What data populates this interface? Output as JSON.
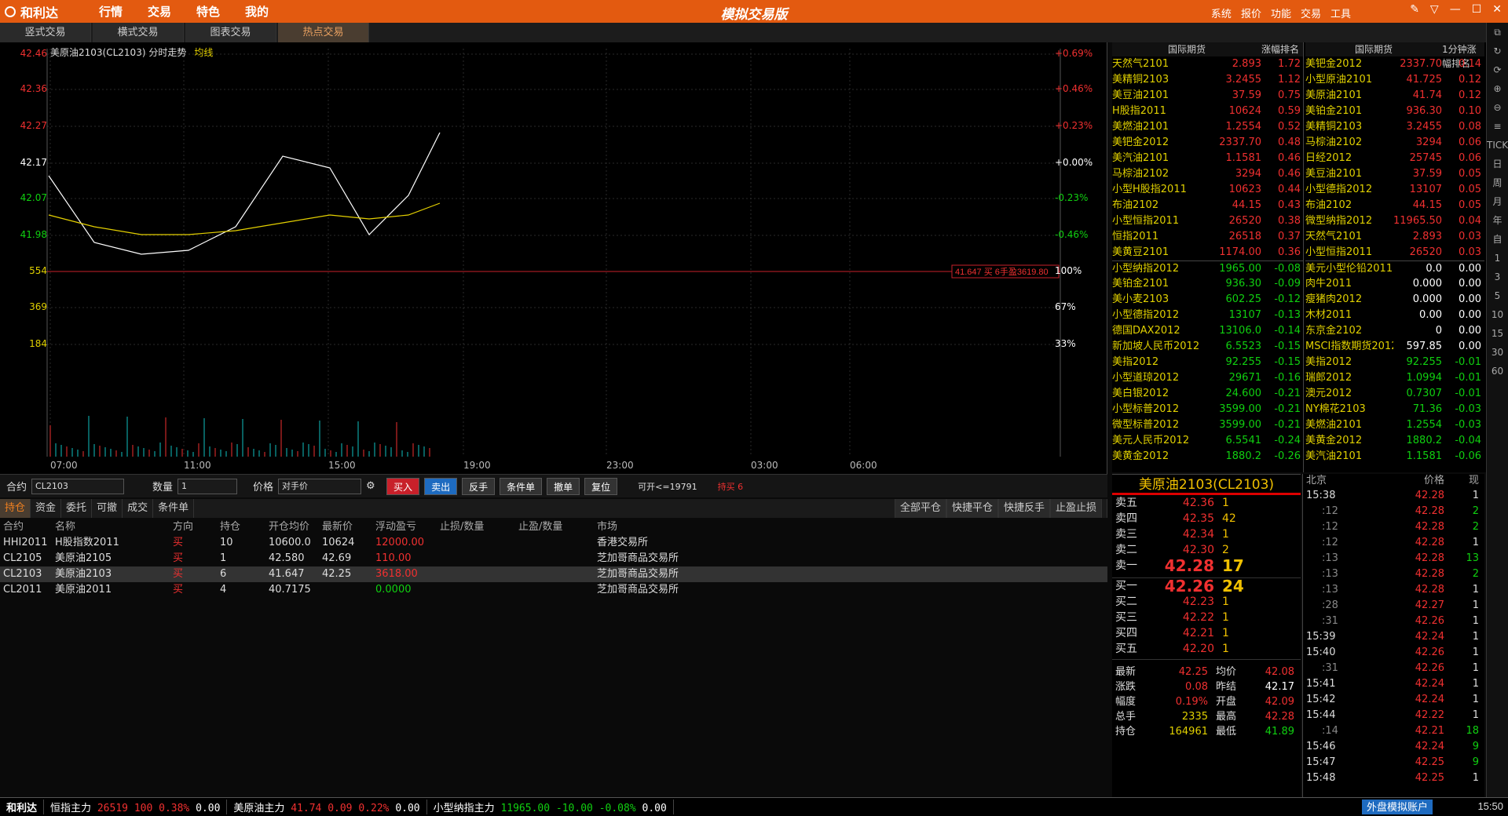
{
  "app": {
    "logo": "和利达",
    "title": "模拟交易版",
    "menu": [
      "行情",
      "交易",
      "特色",
      "我的"
    ],
    "sys": [
      "系统",
      "报价",
      "功能",
      "交易",
      "工具"
    ]
  },
  "tabs": [
    "竖式交易",
    "横式交易",
    "图表交易",
    "热点交易"
  ],
  "chart": {
    "title": "美原油2103(CL2103) 分时走势",
    "avg_label": "均线",
    "left_labels": [
      "42.46",
      "42.36",
      "42.27",
      "42.17",
      "42.07",
      "41.98",
      "554",
      "369",
      "184"
    ],
    "right_labels": [
      "+0.69%",
      "+0.46%",
      "+0.23%",
      "+0.00%",
      "-0.23%",
      "-0.46%",
      "100%",
      "67%",
      "33%"
    ],
    "time_labels": [
      "07:00",
      "11:00",
      "15:00",
      "19:00",
      "23:00",
      "03:00",
      "06:00"
    ],
    "position_tag": "41.647 买 6手盈3619.80"
  },
  "chart_data": {
    "type": "line",
    "title": "美原油2103(CL2103) 分时走势",
    "x": [
      "07:00",
      "08:00",
      "09:00",
      "10:00",
      "11:00",
      "12:00",
      "13:00",
      "14:00",
      "15:00",
      "15:30"
    ],
    "series": [
      {
        "name": "价格",
        "values": [
          42.15,
          41.98,
          41.95,
          41.96,
          42.02,
          42.2,
          42.17,
          42.0,
          42.1,
          42.26
        ]
      },
      {
        "name": "均线",
        "values": [
          42.05,
          42.02,
          42.0,
          42.0,
          42.01,
          42.03,
          42.05,
          42.04,
          42.05,
          42.08
        ]
      }
    ],
    "ylim": [
      41.98,
      42.46
    ]
  },
  "order": {
    "contract_label": "合约",
    "contract": "CL2103",
    "qty_label": "数量",
    "qty": "1",
    "price_label": "价格",
    "price": "对手价",
    "buy": "买入",
    "sell": "卖出",
    "reverse": "反手",
    "cond": "条件单",
    "cancel": "撤单",
    "reset": "复位",
    "available": "可开<=19791",
    "holding": "持买 6"
  },
  "pos_tabs": [
    "持仓",
    "资金",
    "委托",
    "可撤",
    "成交",
    "条件单"
  ],
  "pos_actions": [
    "全部平仓",
    "快捷平仓",
    "快捷反手",
    "止盈止损"
  ],
  "table": {
    "headers": [
      "合约",
      "名称",
      "方向",
      "持仓",
      "开仓均价",
      "最新价",
      "浮动盈亏",
      "止损/数量",
      "止盈/数量",
      "市场"
    ],
    "rows": [
      [
        "HHI2011",
        "H股指数2011",
        "买",
        "10",
        "10600.0",
        "10624",
        "12000.00",
        "",
        "",
        "香港交易所"
      ],
      [
        "CL2105",
        "美原油2105",
        "买",
        "1",
        "42.580",
        "42.69",
        "110.00",
        "",
        "",
        "芝加哥商品交易所"
      ],
      [
        "CL2103",
        "美原油2103",
        "买",
        "6",
        "41.647",
        "42.25",
        "3618.00",
        "",
        "",
        "芝加哥商品交易所"
      ],
      [
        "CL2011",
        "美原油2011",
        "买",
        "4",
        "40.7175",
        "",
        "0.0000",
        "",
        "",
        "芝加哥商品交易所"
      ]
    ]
  },
  "rank1": {
    "h1": "国际期货",
    "h2": "涨幅排名",
    "rows": [
      [
        "天然气2101",
        "2.893",
        "1.72"
      ],
      [
        "美精铜2103",
        "3.2455",
        "1.12"
      ],
      [
        "美豆油2101",
        "37.59",
        "0.75"
      ],
      [
        "H股指2011",
        "10624",
        "0.59"
      ],
      [
        "美燃油2101",
        "1.2554",
        "0.52"
      ],
      [
        "美钯金2012",
        "2337.70",
        "0.48"
      ],
      [
        "美汽油2101",
        "1.1581",
        "0.46"
      ],
      [
        "马棕油2102",
        "3294",
        "0.46"
      ],
      [
        "小型H股指2011",
        "10623",
        "0.44"
      ],
      [
        "布油2102",
        "44.15",
        "0.43"
      ],
      [
        "小型恒指2011",
        "26520",
        "0.38"
      ],
      [
        "恒指2011",
        "26518",
        "0.37"
      ],
      [
        "美黄豆2101",
        "1174.00",
        "0.36"
      ],
      [
        "小型纳指2012",
        "1965.00",
        "-0.08"
      ],
      [
        "美铂金2101",
        "936.30",
        "-0.09"
      ],
      [
        "美小麦2103",
        "602.25",
        "-0.12"
      ],
      [
        "小型德指2012",
        "13107",
        "-0.13"
      ],
      [
        "德国DAX2012",
        "13106.0",
        "-0.14"
      ],
      [
        "新加坡人民币2012",
        "6.5523",
        "-0.15"
      ],
      [
        "美指2012",
        "92.255",
        "-0.15"
      ],
      [
        "小型道琼2012",
        "29671",
        "-0.16"
      ],
      [
        "美白银2012",
        "24.600",
        "-0.21"
      ],
      [
        "小型标普2012",
        "3599.00",
        "-0.21"
      ],
      [
        "微型标普2012",
        "3599.00",
        "-0.21"
      ],
      [
        "美元人民币2012",
        "6.5541",
        "-0.24"
      ],
      [
        "美黄金2012",
        "1880.2",
        "-0.26"
      ]
    ]
  },
  "rank2": {
    "h1": "国际期货",
    "h2": "1分钟涨幅排名",
    "rows": [
      [
        "美钯金2012",
        "2337.70",
        "0.14"
      ],
      [
        "小型原油2101",
        "41.725",
        "0.12"
      ],
      [
        "美原油2101",
        "41.74",
        "0.12"
      ],
      [
        "美铂金2101",
        "936.30",
        "0.10"
      ],
      [
        "美精铜2103",
        "3.2455",
        "0.08"
      ],
      [
        "马棕油2102",
        "3294",
        "0.06"
      ],
      [
        "日经2012",
        "25745",
        "0.06"
      ],
      [
        "美豆油2101",
        "37.59",
        "0.05"
      ],
      [
        "小型德指2012",
        "13107",
        "0.05"
      ],
      [
        "布油2102",
        "44.15",
        "0.05"
      ],
      [
        "微型纳指2012",
        "11965.50",
        "0.04"
      ],
      [
        "天然气2101",
        "2.893",
        "0.03"
      ],
      [
        "小型恒指2011",
        "26520",
        "0.03"
      ],
      [
        "美元小型伦铅2011",
        "0.0",
        "0.00"
      ],
      [
        "肉牛2011",
        "0.000",
        "0.00"
      ],
      [
        "瘦猪肉2012",
        "0.000",
        "0.00"
      ],
      [
        "木材2011",
        "0.00",
        "0.00"
      ],
      [
        "东京金2102",
        "0",
        "0.00"
      ],
      [
        "MSCI指数期货2012",
        "597.85",
        "0.00"
      ],
      [
        "美指2012",
        "92.255",
        "-0.01"
      ],
      [
        "瑞郎2012",
        "1.0994",
        "-0.01"
      ],
      [
        "澳元2012",
        "0.7307",
        "-0.01"
      ],
      [
        "NY棉花2103",
        "71.36",
        "-0.03"
      ],
      [
        "美燃油2101",
        "1.2554",
        "-0.03"
      ],
      [
        "美黄金2012",
        "1880.2",
        "-0.04"
      ],
      [
        "美汽油2101",
        "1.1581",
        "-0.06"
      ]
    ]
  },
  "quote": {
    "title": "美原油2103(CL2103)",
    "asks": [
      [
        "卖五",
        "42.36",
        "1"
      ],
      [
        "卖四",
        "42.35",
        "42"
      ],
      [
        "卖三",
        "42.34",
        "1"
      ],
      [
        "卖二",
        "42.30",
        "2"
      ],
      [
        "卖一",
        "42.28",
        "17"
      ]
    ],
    "bids": [
      [
        "买一",
        "42.26",
        "24"
      ],
      [
        "买二",
        "42.23",
        "1"
      ],
      [
        "买三",
        "42.22",
        "1"
      ],
      [
        "买四",
        "42.21",
        "1"
      ],
      [
        "买五",
        "42.20",
        "1"
      ]
    ],
    "stats": [
      [
        "最新",
        "42.25",
        "均价",
        "42.08"
      ],
      [
        "涨跌",
        "0.08",
        "昨结",
        "42.17"
      ],
      [
        "幅度",
        "0.19%",
        "开盘",
        "42.09"
      ],
      [
        "总手",
        "2335",
        "最高",
        "42.28"
      ],
      [
        "持仓",
        "164961",
        "最低",
        "41.89"
      ]
    ]
  },
  "ticks": {
    "h1": "北京",
    "h2": "价格",
    "h3": "现",
    "rows": [
      [
        "15:38",
        "42.28",
        "1"
      ],
      [
        ":12",
        "42.28",
        "2"
      ],
      [
        ":12",
        "42.28",
        "2"
      ],
      [
        ":12",
        "42.28",
        "1"
      ],
      [
        ":13",
        "42.28",
        "13"
      ],
      [
        ":13",
        "42.28",
        "2"
      ],
      [
        ":13",
        "42.28",
        "1"
      ],
      [
        ":28",
        "42.27",
        "1"
      ],
      [
        ":31",
        "42.26",
        "1"
      ],
      [
        "15:39",
        "42.24",
        "1"
      ],
      [
        "15:40",
        "42.26",
        "1"
      ],
      [
        ":31",
        "42.26",
        "1"
      ],
      [
        "15:41",
        "42.24",
        "1"
      ],
      [
        "15:42",
        "42.24",
        "1"
      ],
      [
        "15:44",
        "42.22",
        "1"
      ],
      [
        ":14",
        "42.21",
        "18"
      ],
      [
        "15:46",
        "42.24",
        "9"
      ],
      [
        "15:47",
        "42.25",
        "9"
      ],
      [
        "15:48",
        "42.25",
        "1"
      ]
    ]
  },
  "status": {
    "logo": "和利达",
    "items": [
      [
        "恒指主力",
        "26519",
        "100",
        "0.38%",
        "0.00"
      ],
      [
        "美原油主力",
        "41.74",
        "0.09",
        "0.22%",
        "0.00"
      ],
      [
        "小型纳指主力",
        "11965.00",
        "-10.00",
        "-0.08%",
        "0.00"
      ]
    ],
    "sim_btn": "外盘模拟账户",
    "clock": "15:50"
  },
  "tools": [
    "⧉",
    "↻",
    "⟳",
    "⊕",
    "⊖",
    "≡",
    "TICK",
    "日",
    "周",
    "月",
    "年",
    "自",
    "1",
    "3",
    "5",
    "10",
    "15",
    "30",
    "60"
  ]
}
